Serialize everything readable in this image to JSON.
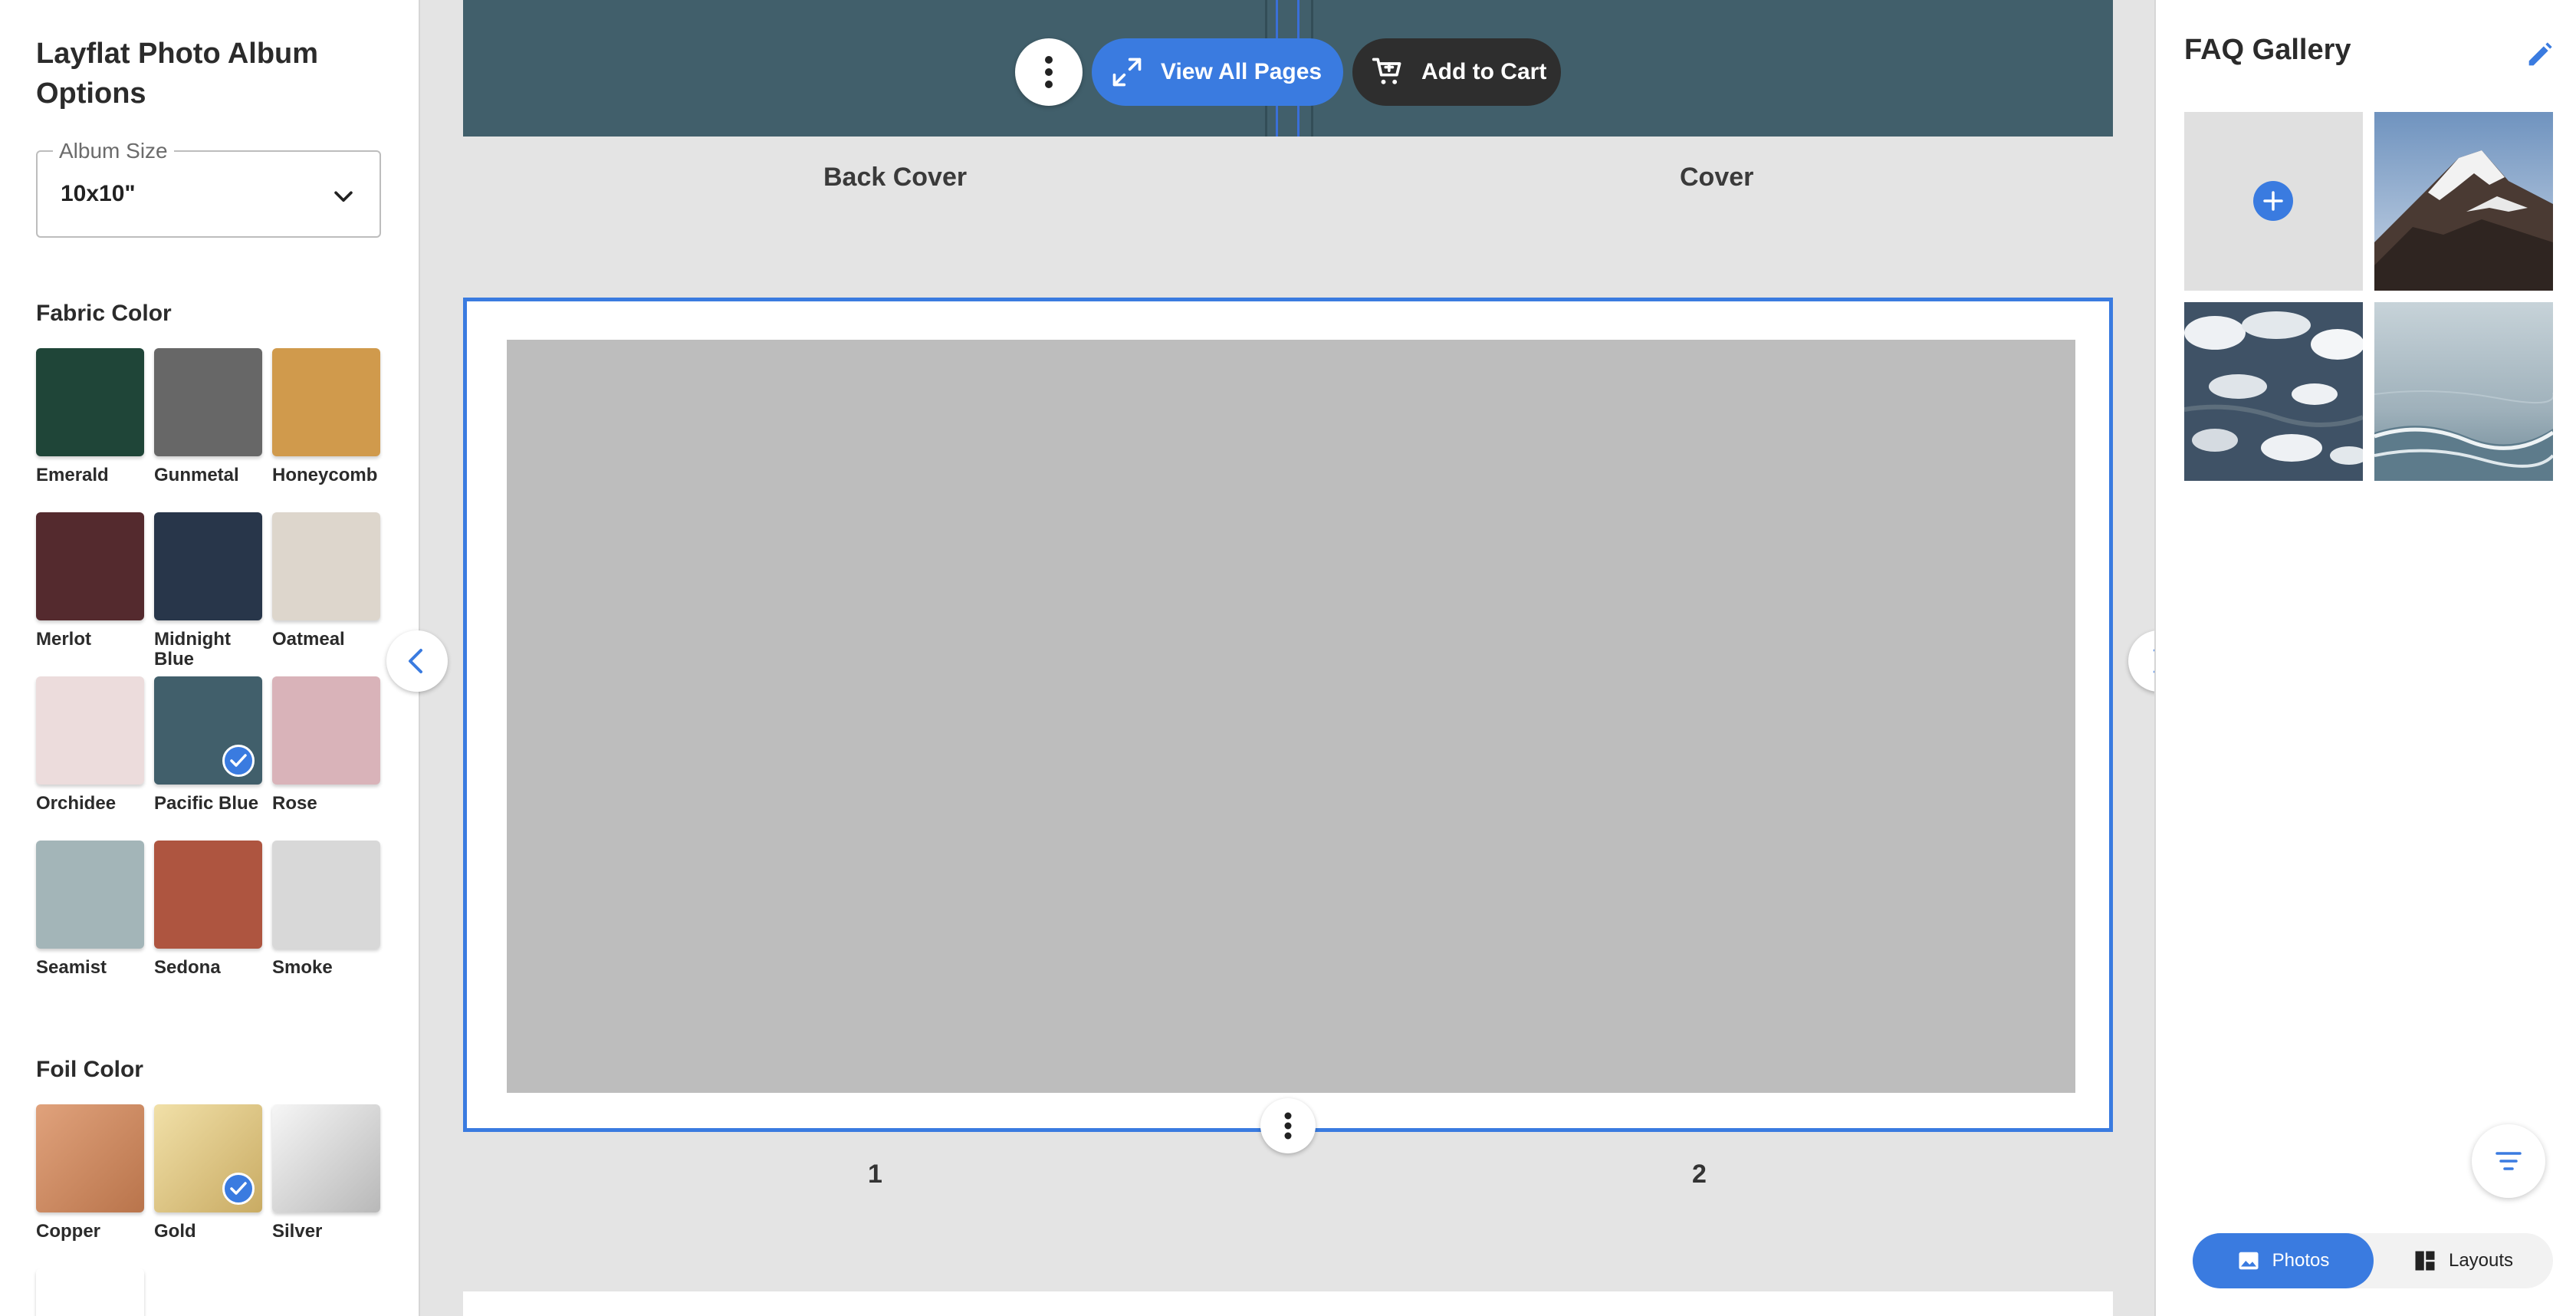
{
  "left_panel": {
    "title": "Layflat Photo Album Options",
    "album_size": {
      "legend": "Album Size",
      "value": "10x10\""
    },
    "fabric_section_title": "Fabric Color",
    "fabric_colors": [
      {
        "name": "Emerald",
        "color": "#1f4538",
        "selected": false
      },
      {
        "name": "Gunmetal",
        "color": "#676767",
        "selected": false
      },
      {
        "name": "Honeycomb",
        "color": "#d09a4c",
        "selected": false
      },
      {
        "name": "Merlot",
        "color": "#542a2e",
        "selected": false
      },
      {
        "name": "Midnight Blue",
        "color": "#28364a",
        "selected": false
      },
      {
        "name": "Oatmeal",
        "color": "#ddd6cc",
        "selected": false
      },
      {
        "name": "Orchidee",
        "color": "#ecdcdc",
        "selected": false
      },
      {
        "name": "Pacific Blue",
        "color": "#415f6b",
        "selected": true
      },
      {
        "name": "Rose",
        "color": "#d9b3b9",
        "selected": false
      },
      {
        "name": "Seamist",
        "color": "#a3b5b8",
        "selected": false
      },
      {
        "name": "Sedona",
        "color": "#ae5540",
        "selected": false
      },
      {
        "name": "Smoke",
        "color": "#d8d8d8",
        "selected": false
      }
    ],
    "foil_section_title": "Foil Color",
    "foil_colors": [
      {
        "name": "Copper",
        "color": "#c98a63",
        "selected": false
      },
      {
        "name": "Gold",
        "color": "#dcc587",
        "selected": true
      },
      {
        "name": "Silver",
        "color": "#d4d4d4",
        "selected": false
      }
    ]
  },
  "toolbar": {
    "view_all_label": "View All Pages",
    "add_to_cart_label": "Add to Cart"
  },
  "cover_spread": {
    "back_cover_label": "Back Cover",
    "cover_label": "Cover",
    "fabric_color": "#415f6b"
  },
  "current_spread": {
    "left_page_number": "1",
    "right_page_number": "2",
    "selected_border_color": "#3a7be0"
  },
  "right_panel": {
    "title": "FAQ Gallery",
    "photos": [
      "add-photo",
      "mountain-snow-photo",
      "aerial-clouds-photo",
      "ocean-waves-photo"
    ],
    "tabs": {
      "photos_label": "Photos",
      "layouts_label": "Layouts",
      "active": "Photos"
    }
  },
  "colors": {
    "accent": "#3a7be0",
    "dark": "#2e2e2e"
  }
}
